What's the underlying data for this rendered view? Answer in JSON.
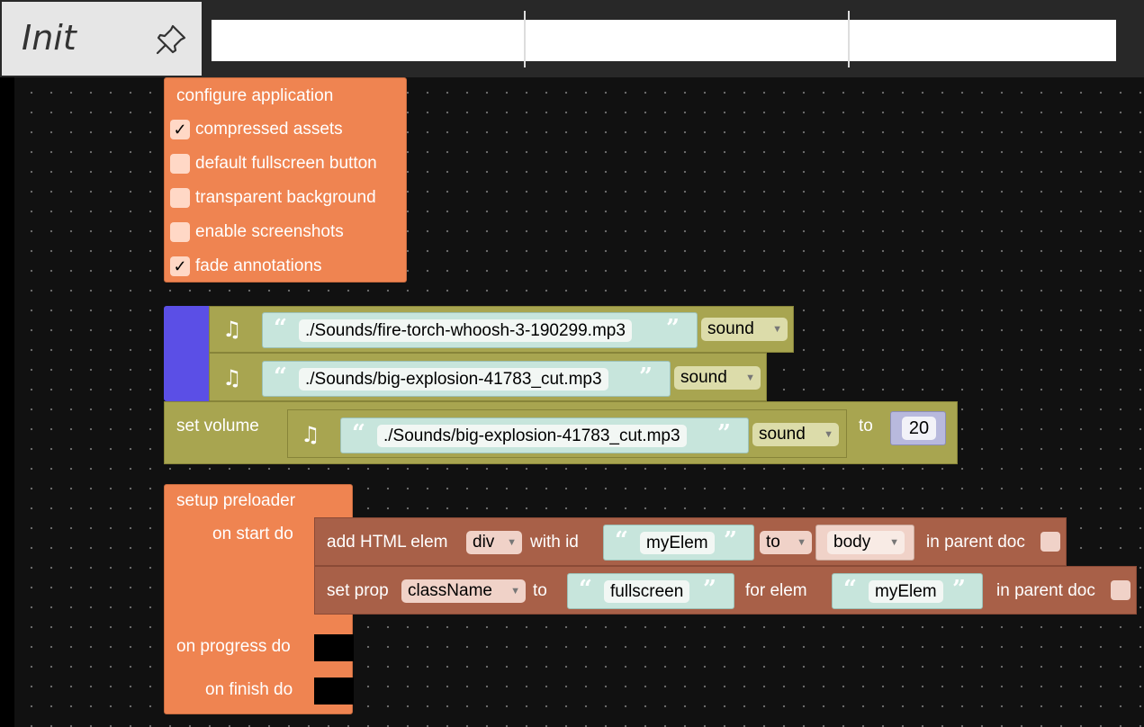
{
  "tab": {
    "title": "Init",
    "pin_icon": "pin-icon"
  },
  "configure_app": {
    "title": "configure application",
    "options": [
      {
        "label": "compressed assets",
        "checked": true
      },
      {
        "label": "default fullscreen button",
        "checked": false
      },
      {
        "label": "transparent background",
        "checked": false
      },
      {
        "label": "enable screenshots",
        "checked": false
      },
      {
        "label": "fade annotations",
        "checked": true
      }
    ]
  },
  "sounds": [
    {
      "path": "./Sounds/fire-torch-whoosh-3-190299.mp3",
      "type": "sound"
    },
    {
      "path": "./Sounds/big-explosion-41783_cut.mp3",
      "type": "sound"
    }
  ],
  "set_volume": {
    "label": "set volume",
    "path": "./Sounds/big-explosion-41783_cut.mp3",
    "type": "sound",
    "to_label": "to",
    "value": "20"
  },
  "preloader": {
    "title": "setup preloader",
    "on_start": "on start do",
    "on_progress": "on progress do",
    "on_finish": "on finish do"
  },
  "add_html": {
    "label": "add HTML elem",
    "elem_type": "div",
    "with_id": "with id",
    "id": "myElem",
    "to_label": "to",
    "parent": "body",
    "in_parent": "in parent doc"
  },
  "set_prop": {
    "label": "set prop",
    "prop": "className",
    "to_label": "to",
    "value": "fullscreen",
    "for_elem": "for elem",
    "elem": "myElem",
    "in_parent": "in parent doc"
  },
  "colors": {
    "orange": "#ef8451",
    "olive": "#a8a550",
    "brown": "#a86048",
    "purple": "#5b4fe6",
    "text_block": "#c7e5dc"
  }
}
